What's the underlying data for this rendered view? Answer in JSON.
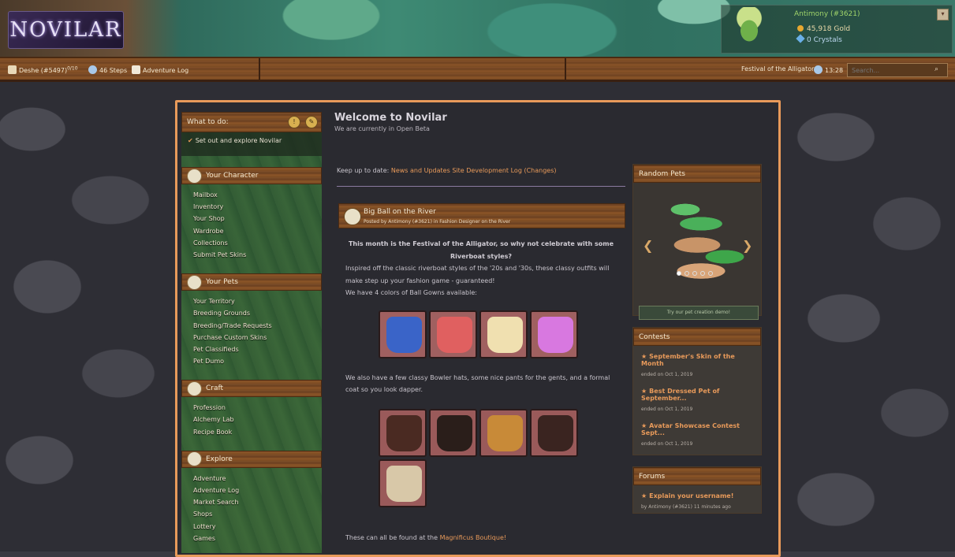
{
  "brand": {
    "logo_text": "NOVILAR"
  },
  "user": {
    "name": "Antimony (#3621)",
    "gold": "45,918 Gold",
    "crystals": "0 Crystals"
  },
  "nav": {
    "user_label": "Deshe (#5497)",
    "user_suffix": "0/10",
    "steps": "46 Steps",
    "adventure_log": "Adventure Log",
    "festival": "Festival of the Alligator",
    "time": "13:28",
    "search_placeholder": "Search..."
  },
  "todo": {
    "header": "What to do:",
    "item": "Set out and explore Novilar"
  },
  "sections": [
    {
      "title": "Your Character",
      "items": [
        "Mailbox",
        "Inventory",
        "Your Shop",
        "Wardrobe",
        "Collections",
        "Submit Pet Skins"
      ]
    },
    {
      "title": "Your Pets",
      "items": [
        "Your Territory",
        "Breeding Grounds",
        "Breeding/Trade Requests",
        "Purchase Custom Skins",
        "Pet Classifieds",
        "Pet Dumo"
      ]
    },
    {
      "title": "Craft",
      "items": [
        "Profession",
        "Alchemy Lab",
        "Recipe Book"
      ]
    },
    {
      "title": "Explore",
      "items": [
        "Adventure",
        "Adventure Log",
        "Market Search",
        "Shops",
        "Lottery",
        "Games"
      ]
    }
  ],
  "main": {
    "title": "Welcome to Novilar",
    "subtitle": "We are currently in Open Beta",
    "keepup_label": "Keep up to date:",
    "link_news": "News and Updates",
    "link_dev": "Site Development Log (Changes)",
    "news_title": "Big Ball on the River",
    "news_author": "Posted by Antimony (#3621) in Fashion Designer on the River",
    "intro_bold": "This month is the Festival of the Alligator, so why not celebrate with some Riverboat styles?",
    "intro_line1": "Inspired off the classic riverboat styles of the '20s and '30s, these classy outfits will make step up your fashion game - guaranteed!",
    "intro_line2": "We have 4 colors of Ball Gowns available:",
    "para2": "We also have a few classy Bowler hats, some nice pants for the gents, and a formal coat so you look dapper.",
    "found_prefix": "These can all be found at the ",
    "found_link": "Magnificus Boutique!"
  },
  "gowns": [
    {
      "color": "#3a64c8"
    },
    {
      "color": "#e06060"
    },
    {
      "color": "#f0e0b0"
    },
    {
      "color": "#d878e0"
    }
  ],
  "apparel": [
    {
      "color": "#4a2a22"
    },
    {
      "color": "#2a1e1a"
    },
    {
      "color": "#c88a38"
    },
    {
      "color": "#3a2420"
    },
    {
      "color": "#d8c8a8"
    }
  ],
  "random_pets": {
    "header": "Random Pets",
    "try_label": "Try our pet creation demo!"
  },
  "contests": {
    "header": "Contests",
    "entries": [
      {
        "title": "September's Skin of the Month",
        "date": "ended on Oct 1, 2019"
      },
      {
        "title": "Best Dressed Pet of September...",
        "date": "ended on Oct 1, 2019"
      },
      {
        "title": "Avatar Showcase Contest Sept...",
        "date": "ended on Oct 1, 2019"
      }
    ]
  },
  "forums": {
    "header": "Forums",
    "entries": [
      {
        "title": "Explain your username!",
        "date": "by Antimony (#3621) 11 minutes ago"
      }
    ]
  }
}
